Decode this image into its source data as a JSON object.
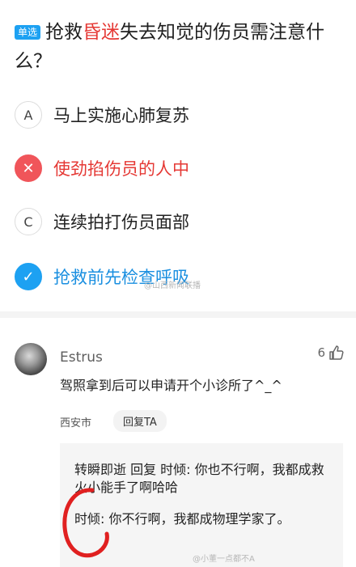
{
  "question": {
    "type_label": "单选",
    "prefix": "抢救",
    "highlight": "昏迷",
    "suffix": "失去知觉的伤员需注意什么？"
  },
  "options": [
    {
      "letter": "A",
      "text": "马上实施心肺复苏",
      "state": "neutral"
    },
    {
      "letter": "✕",
      "text": "使劲掐伤员的人中",
      "state": "wrong"
    },
    {
      "letter": "C",
      "text": "连续拍打伤员面部",
      "state": "neutral"
    },
    {
      "letter": "✓",
      "text": "抢救前先检查呼吸",
      "state": "correct"
    }
  ],
  "watermark_mid": "@山西新闻联播",
  "comment": {
    "username": "Estrus",
    "like_count": "6",
    "text": "驾照拿到后可以申请开个小诊所了^_^",
    "location": "西安市",
    "reply_label": "回复TA",
    "replies": [
      "转瞬即逝 回复 时倾: 你也不行啊，我都成救火小能手了啊哈哈",
      "时倾: 你不行啊，我都成物理学家了。"
    ]
  },
  "watermark_bottom": "@小董一点都不A",
  "colors": {
    "accent_blue": "#1da1f2",
    "wrong_red": "#f0555a",
    "highlight_red": "#e53935"
  }
}
